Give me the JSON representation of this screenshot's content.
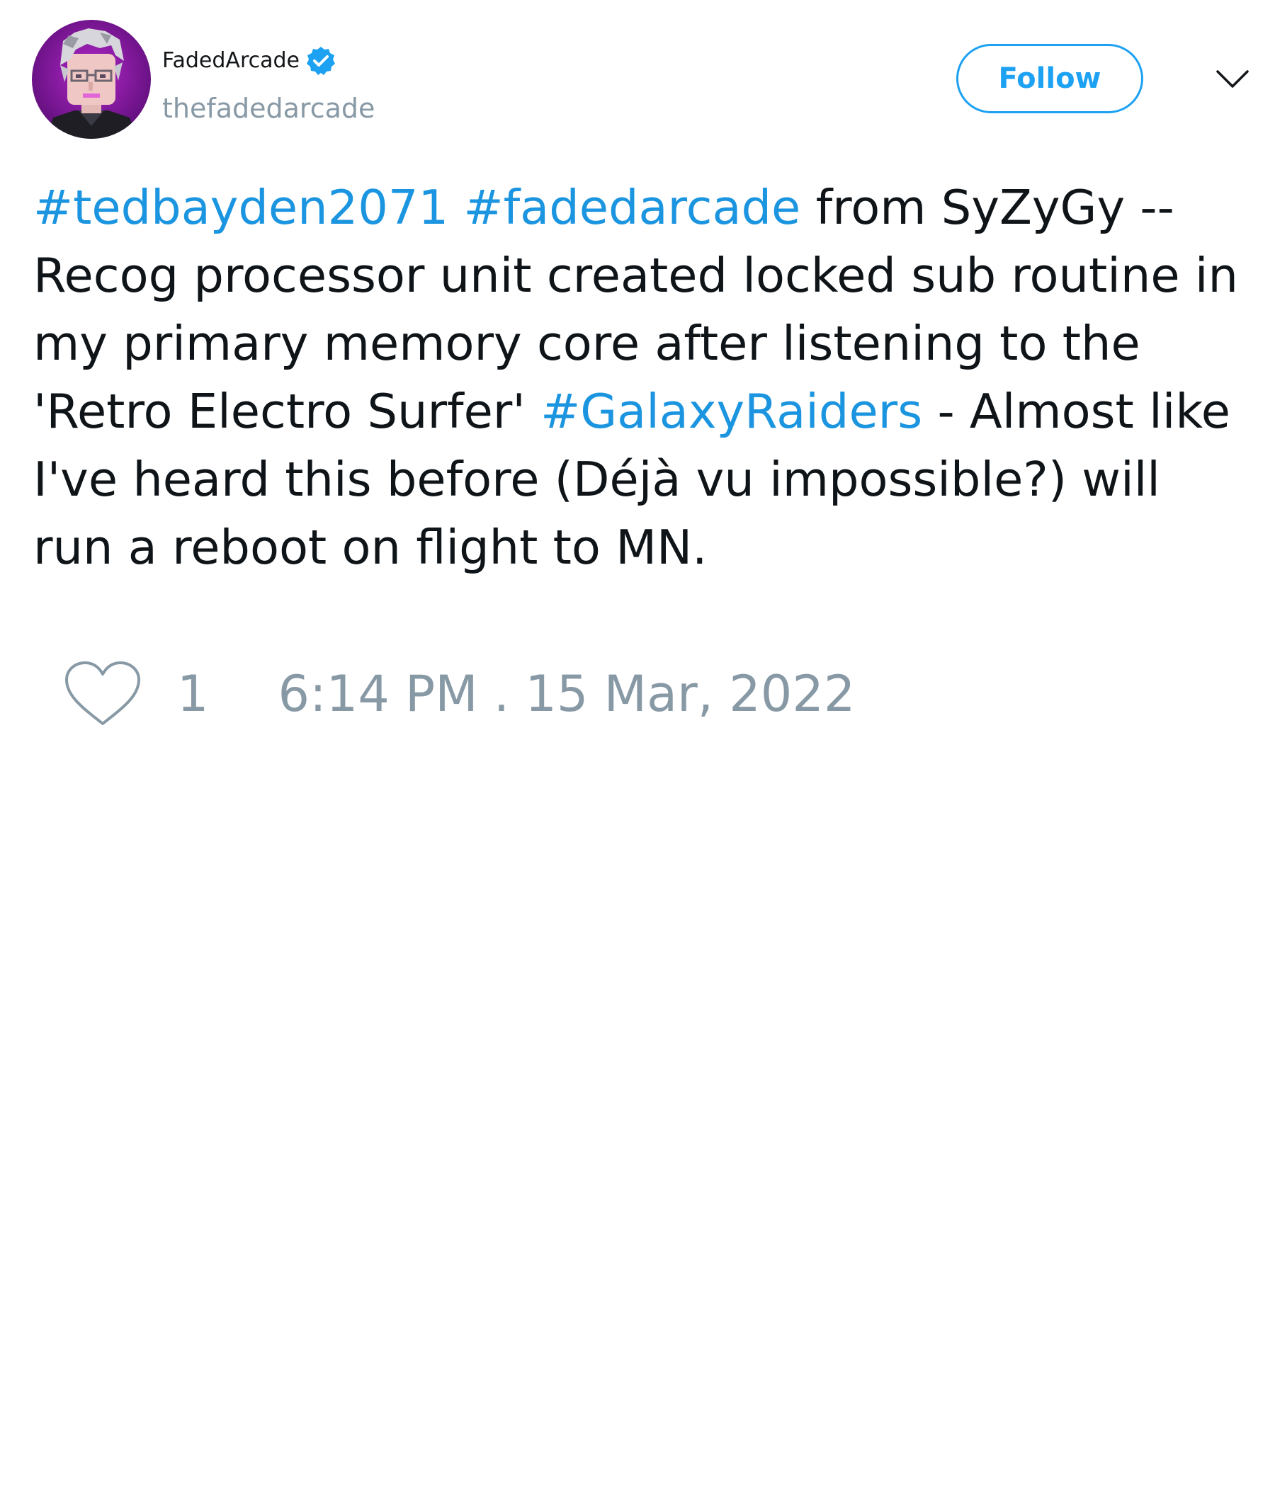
{
  "author": {
    "display_name": "FadedArcade",
    "handle": "thefadedarcade",
    "verified": true,
    "avatar_icon": "pixel-art-avatar"
  },
  "actions": {
    "follow_label": "Follow",
    "menu_icon": "chevron-down-icon"
  },
  "tweet": {
    "hashtag_1": "#tedbayden2071",
    "hashtag_2": "#fadedarcade",
    "text_1": "from SyZyGy -- Recog processor unit created locked sub routine in my primary memory core after listening to the 'Retro Electro Surfer'",
    "hashtag_3": "#GalaxyRaiders",
    "text_2": "- Almost like I've heard this before (Déjà vu impossible?) will run a reboot on flight to MN."
  },
  "footer": {
    "like_icon": "heart-outline-icon",
    "like_count": "1",
    "timestamp": "6:14 PM . 15 Mar, 2022"
  },
  "colors": {
    "accent": "#1da1f2",
    "hashtag": "#1b95e0",
    "muted": "#8899a6",
    "text": "#0f1419"
  }
}
